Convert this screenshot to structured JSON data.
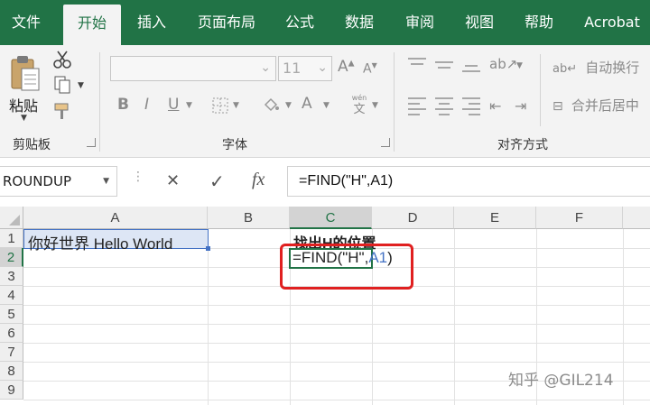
{
  "tabs": [
    "文件",
    "开始",
    "插入",
    "页面布局",
    "公式",
    "数据",
    "审阅",
    "视图",
    "帮助",
    "Acrobat"
  ],
  "ribbon": {
    "clipboard": {
      "paste_label": "粘贴",
      "group_label": "剪贴板"
    },
    "font": {
      "font_size": "11",
      "grow_label": "A",
      "shrink_label": "A",
      "bold": "B",
      "italic": "I",
      "underline": "U",
      "font_color_label": "A",
      "phonetic_top": "wén",
      "phonetic_bottom": "文",
      "group_label": "字体"
    },
    "alignment": {
      "wrap_label": "自动换行",
      "merge_label": "合并后居中",
      "group_label": "对齐方式"
    }
  },
  "formula_bar": {
    "name_box": "ROUNDUP",
    "cancel_icon": "✕",
    "enter_icon": "✓",
    "fx_label": "fx",
    "formula": "=FIND(\"H\",A1)"
  },
  "grid": {
    "columns": [
      "A",
      "B",
      "C",
      "D",
      "E",
      "F"
    ],
    "rows": [
      "1",
      "2",
      "3",
      "4",
      "5",
      "6",
      "7",
      "8",
      "9"
    ],
    "cells": {
      "A1": "你好世界 Hello World",
      "C1": "找出H的位置",
      "C2_prefix": "=FIND(\"H\",",
      "C2_ref": "A1",
      "C2_suffix": ")"
    }
  },
  "watermark": "知乎 @GIL214",
  "colors": {
    "brand": "#217346",
    "highlight": "#e02020",
    "ref": "#4472c4"
  }
}
